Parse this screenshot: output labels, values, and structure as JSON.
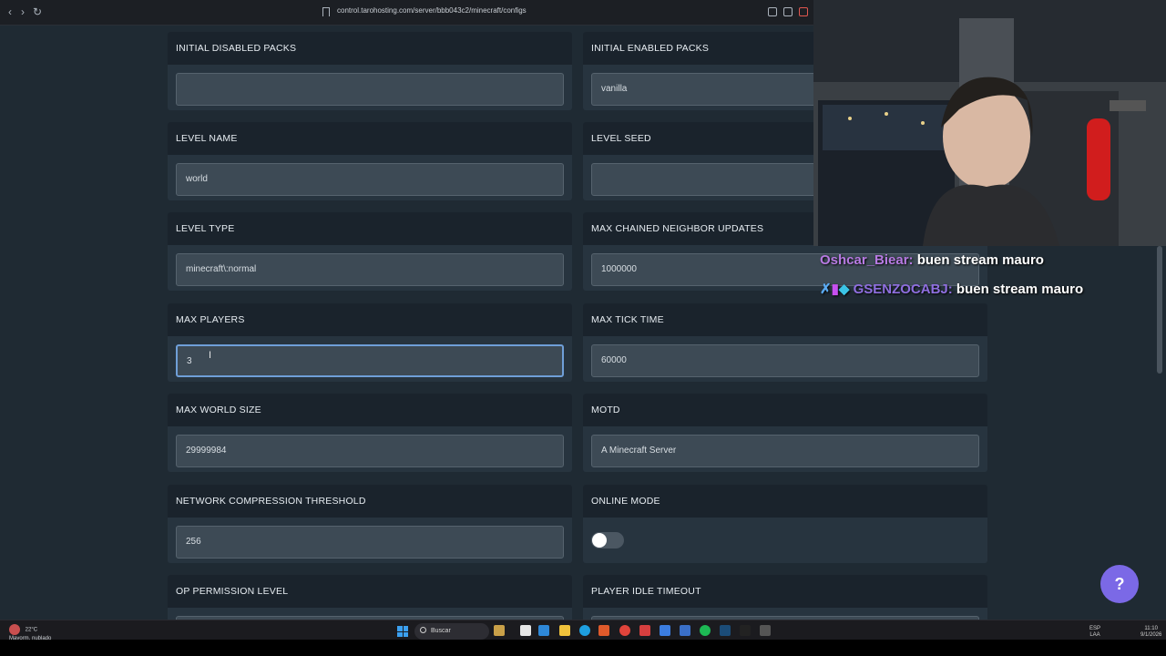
{
  "browser": {
    "url": "control.tarohosting.com/server/bbb043c2/minecraft/configs"
  },
  "config": {
    "fields": [
      {
        "label": "INITIAL DISABLED PACKS",
        "value": ""
      },
      {
        "label": "INITIAL ENABLED PACKS",
        "value": "vanilla"
      },
      {
        "label": "LEVEL NAME",
        "value": "world"
      },
      {
        "label": "LEVEL SEED",
        "value": ""
      },
      {
        "label": "LEVEL TYPE",
        "value": "minecraft\\:normal"
      },
      {
        "label": "MAX CHAINED NEIGHBOR UPDATES",
        "value": "1000000"
      },
      {
        "label": "MAX PLAYERS",
        "value": "3"
      },
      {
        "label": "MAX TICK TIME",
        "value": "60000"
      },
      {
        "label": "MAX WORLD SIZE",
        "value": "29999984"
      },
      {
        "label": "MOTD",
        "value": "A Minecraft Server"
      },
      {
        "label": "NETWORK COMPRESSION THRESHOLD",
        "value": "256"
      },
      {
        "label": "ONLINE MODE",
        "enabled": false
      },
      {
        "label": "OP PERMISSION LEVEL",
        "value": ""
      },
      {
        "label": "PLAYER IDLE TIMEOUT",
        "value": ""
      }
    ]
  },
  "chat": {
    "messages": [
      {
        "user": "Oshcar_Biear:",
        "text": "buen stream mauro"
      },
      {
        "user": "GSENZOCABJ:",
        "text": "buen stream mauro"
      }
    ]
  },
  "help": {
    "label": "?"
  },
  "taskbar": {
    "weather_temp": "22°C",
    "weather_desc": "Mayorm. nublado",
    "search_label": "Buscar",
    "lang_1": "ESP",
    "lang_2": "LAA",
    "time": "11:10",
    "date": "9/1/2026"
  },
  "colors": {
    "accent": "#7b69e6",
    "focus_border": "#6f9fd8",
    "card_bg": "#27343f",
    "card_header_bg": "#1a232c"
  }
}
